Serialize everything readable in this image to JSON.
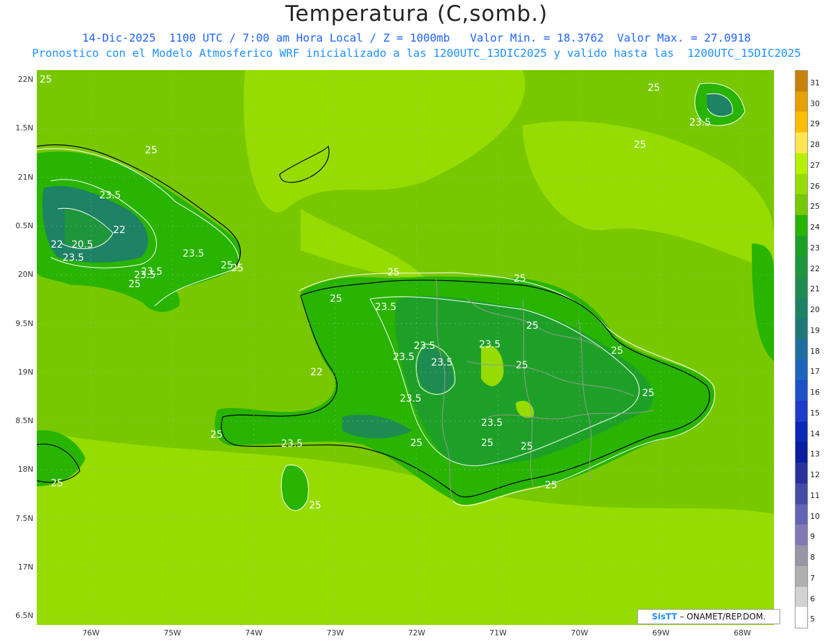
{
  "header": {
    "title": "Temperatura (C,somb.)",
    "line1": "14-Dic-2025  1100 UTC / 7:00 am Hora Local / Z = 1000mb   Valor Min. = 18.3762  Valor Max. = 27.0918",
    "line2": "Pronostico con el Modelo Atmosferico WRF inicializado a las 1200UTC_13DIC2025 y valido hasta las  1200UTC_15DIC2025"
  },
  "axes": {
    "lat_labels": [
      "22N",
      "1.5N",
      "21N",
      "0.5N",
      "20N",
      "9.5N",
      "19N",
      "8.5N",
      "18N",
      "7.5N",
      "17N",
      "6.5N"
    ],
    "lon_labels": [
      "76W",
      "75W",
      "74W",
      "73W",
      "72W",
      "71W",
      "70W",
      "69W",
      "68W"
    ]
  },
  "colorbar": {
    "labels": [
      "31",
      "30",
      "29",
      "28",
      "27",
      "26",
      "25",
      "24",
      "23",
      "22",
      "21",
      "20",
      "19",
      "18",
      "17",
      "16",
      "15",
      "14",
      "13",
      "12",
      "11",
      "10",
      "9",
      "8",
      "7",
      "6",
      "5"
    ],
    "colors": [
      "#c8820a",
      "#e6a000",
      "#ffbe00",
      "#ffe650",
      "#b4f000",
      "#96dc00",
      "#78c800",
      "#28b400",
      "#1ea028",
      "#1e963c",
      "#1e8c50",
      "#1e8264",
      "#1e7878",
      "#1e6ea0",
      "#1e64be",
      "#1e50c8",
      "#1e3cc8",
      "#0a28b4",
      "#0a1ea0",
      "#28329b",
      "#464ba5",
      "#6464b4",
      "#8278b4",
      "#9696a5",
      "#afafaf",
      "#d2d2d2",
      "#ffffff"
    ]
  },
  "contour_labels": [
    "25",
    "25",
    "23.5",
    "25",
    "23.5",
    "22",
    "22",
    "20.5",
    "23.5",
    "23.5",
    "25",
    "23.5",
    "25",
    "25",
    "25",
    "25",
    "23.5",
    "25",
    "23.5",
    "23.5",
    "25",
    "23.5",
    "25",
    "23.5",
    "22",
    "25",
    "23.5",
    "23.5",
    "25",
    "23.5",
    "25",
    "25",
    "25",
    "25",
    "25",
    "25",
    "25",
    "25",
    "23.5"
  ],
  "credit": {
    "logo": "SisTT",
    "text": "– ONAMET/REP.DOM."
  },
  "colors": {
    "sea": "#78c800",
    "light": "#96dc00",
    "land": "#28b400",
    "warm": "#1ea028",
    "cool": "#1e8264",
    "contour": "#ffffff",
    "coast": "#000000",
    "border": "#999999"
  }
}
